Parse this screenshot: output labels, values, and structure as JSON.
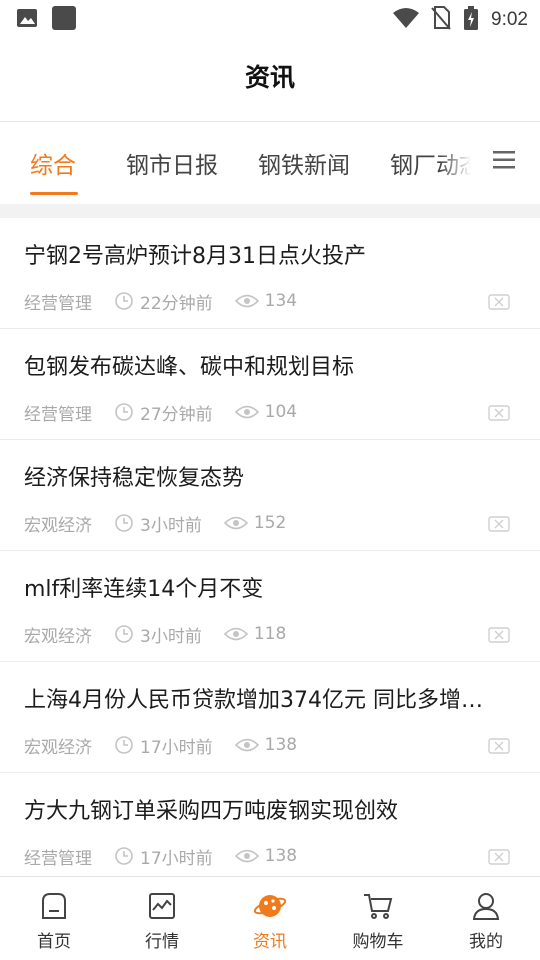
{
  "status_bar": {
    "time": "9:02",
    "icons": [
      "image-icon",
      "app-square-icon",
      "wifi-icon",
      "no-sim-icon",
      "battery-charging-icon"
    ]
  },
  "header": {
    "title": "资讯"
  },
  "tabs": [
    {
      "label": "综合",
      "active": true
    },
    {
      "label": "钢市日报",
      "active": false
    },
    {
      "label": "钢铁新闻",
      "active": false
    },
    {
      "label": "钢厂动态",
      "active": false
    }
  ],
  "tab_menu_icon": "hamburger-menu-icon",
  "news": [
    {
      "title": "宁钢2号高炉预计8月31日点火投产",
      "category": "经营管理",
      "time": "22分钟前",
      "views": "134"
    },
    {
      "title": "包钢发布碳达峰、碳中和规划目标",
      "category": "经营管理",
      "time": "27分钟前",
      "views": "104"
    },
    {
      "title": "经济保持稳定恢复态势",
      "category": "宏观经济",
      "time": "3小时前",
      "views": "152"
    },
    {
      "title": "mlf利率连续14个月不变",
      "category": "宏观经济",
      "time": "3小时前",
      "views": "118"
    },
    {
      "title": "上海4月份人民币贷款增加374亿元 同比多增…",
      "category": "宏观经济",
      "time": "17小时前",
      "views": "138"
    },
    {
      "title": "方大九钢订单采购四万吨废钢实现创效",
      "category": "经营管理",
      "time": "17小时前",
      "views": "138"
    }
  ],
  "bottom_nav": [
    {
      "label": "首页",
      "icon": "home-icon",
      "active": false
    },
    {
      "label": "行情",
      "icon": "chart-icon",
      "active": false
    },
    {
      "label": "资讯",
      "icon": "news-planet-icon",
      "active": true
    },
    {
      "label": "购物车",
      "icon": "cart-icon",
      "active": false
    },
    {
      "label": "我的",
      "icon": "user-icon",
      "active": false
    }
  ],
  "colors": {
    "accent": "#f07a1c",
    "text": "#1c1c1c",
    "meta": "#a9a9a9",
    "divider": "#ececec"
  }
}
